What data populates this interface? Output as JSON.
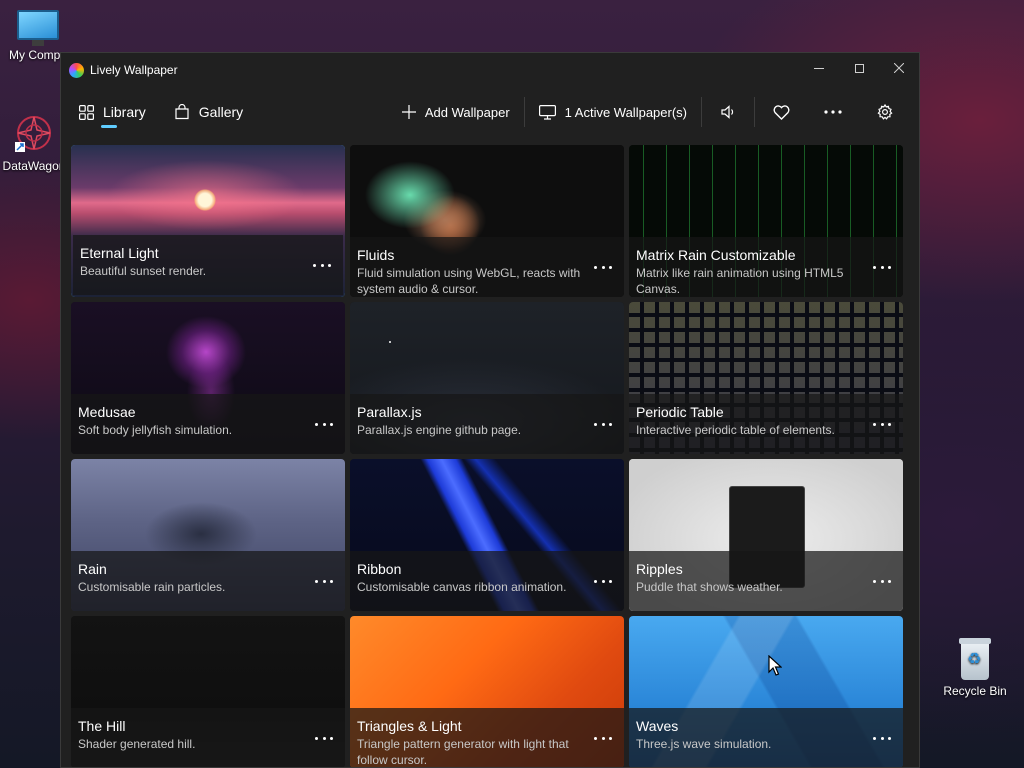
{
  "desktop": {
    "icons": [
      {
        "label": "My Compu",
        "icon": "computer-icon"
      },
      {
        "label": "DataWagon",
        "icon": "datawagon-icon"
      },
      {
        "label": "Recycle Bin",
        "icon": "recycle-bin-icon"
      }
    ]
  },
  "window": {
    "title": "Lively Wallpaper",
    "accent_color": "#60cdff"
  },
  "nav": {
    "tabs": [
      {
        "label": "Library",
        "icon": "grid-icon",
        "active": true
      },
      {
        "label": "Gallery",
        "icon": "shopping-bag-icon",
        "active": false
      }
    ]
  },
  "toolbar": {
    "add_wallpaper": "Add Wallpaper",
    "active_wallpapers": "1 Active Wallpaper(s)",
    "icons": [
      "plus-icon",
      "monitor-icon",
      "volume-icon",
      "heart-icon",
      "more-icon",
      "gear-icon"
    ]
  },
  "wallpapers": [
    {
      "title": "Eternal Light",
      "description": "Beautiful sunset render.",
      "selected": true
    },
    {
      "title": "Fluids",
      "description": "Fluid simulation using WebGL, reacts with system audio & cursor."
    },
    {
      "title": "Matrix Rain Customizable",
      "description": "Matrix like rain animation using HTML5 Canvas."
    },
    {
      "title": "Medusae",
      "description": "Soft body jellyfish simulation."
    },
    {
      "title": "Parallax.js",
      "description": "Parallax.js engine github page."
    },
    {
      "title": "Periodic Table",
      "description": "Interactive periodic table of elements."
    },
    {
      "title": "Rain",
      "description": "Customisable rain particles."
    },
    {
      "title": "Ribbon",
      "description": "Customisable canvas ribbon animation."
    },
    {
      "title": "Ripples",
      "description": "Puddle that shows weather."
    },
    {
      "title": "The Hill",
      "description": "Shader generated hill."
    },
    {
      "title": "Triangles & Light",
      "description": "Triangle pattern generator with light that follow cursor."
    },
    {
      "title": "Waves",
      "description": "Three.js wave simulation."
    }
  ]
}
